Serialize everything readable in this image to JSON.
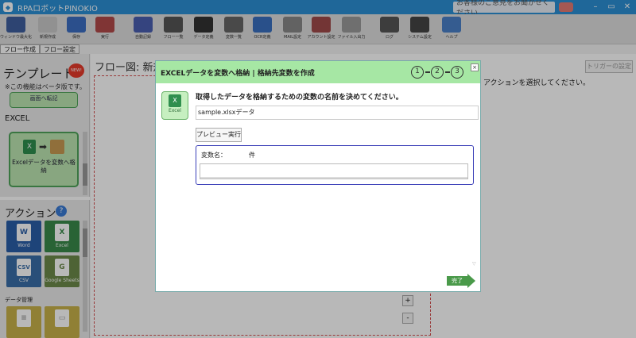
{
  "app": {
    "title": "RPAロボットPINOKIO",
    "feedback": "お客様のご意見をお聞かせください"
  },
  "window": {
    "minimize": "–",
    "restore": "▭",
    "close": "✕"
  },
  "toolbar": [
    {
      "label": "ウィンドウ最大化",
      "color": "#3f5f9f"
    },
    {
      "label": "新規作成",
      "color": "#c9c9c9"
    },
    {
      "label": "保存",
      "color": "#3c6ec2"
    },
    {
      "label": "実行",
      "color": "#b24a4a"
    },
    {
      "label": "自動記録",
      "color": "#4a5fb0"
    },
    {
      "label": "フロー一覧",
      "color": "#555"
    },
    {
      "label": "データ定義",
      "color": "#333"
    },
    {
      "label": "変数一覧",
      "color": "#666"
    },
    {
      "label": "OCR定義",
      "color": "#3a70c0"
    },
    {
      "label": "MAIL設定",
      "color": "#888"
    },
    {
      "label": "アカウント設定",
      "color": "#a04a4a"
    },
    {
      "label": "ファイル入出力",
      "color": "#9a9a9a"
    },
    {
      "label": "ログ",
      "color": "#555"
    },
    {
      "label": "システム設定",
      "color": "#444"
    },
    {
      "label": "ヘルプ",
      "color": "#4a80c8"
    }
  ],
  "tabs": [
    "フロー作成",
    "フロー設定"
  ],
  "left": {
    "templates_title": "テンプレート",
    "new_badge": "NEW!",
    "beta_note": "※この機能はベータ版です。",
    "template_card": "画面へ転記",
    "excel_section": "EXCEL",
    "excel_card": "Excelデータを変数へ格納",
    "actions_title": "アクション",
    "help": "?",
    "tiles": [
      {
        "label": "Word",
        "letter": "W",
        "color": "#2a5fa8"
      },
      {
        "label": "Excel",
        "letter": "X",
        "color": "#3a8a4a"
      },
      {
        "label": "CSV",
        "letter": "CSV",
        "color": "#3a6ea8"
      },
      {
        "label": "Google Sheets",
        "letter": "G",
        "color": "#6d8a4a"
      }
    ],
    "data_section": "データ管理"
  },
  "main": {
    "flow_title": "フロー図: 新規",
    "trigger_button": "トリガーの設定",
    "action_message": "アクションを選択してください。",
    "zoom_in": "+",
    "zoom_out": "-"
  },
  "dialog": {
    "title": "EXCELデータを変数へ格納 | 格納先変数を作成",
    "steps": [
      "1",
      "2",
      "3"
    ],
    "close": "×",
    "excel_caption": "Excel",
    "instruction": "取得したデータを格納するための変数の名前を決めてください。",
    "sheet_value": "sample.xlsxデータ",
    "preview_button": "プレビュー実行",
    "var_label": "変数名：",
    "var_count": "件",
    "var_value": "",
    "done_button": "完了"
  }
}
